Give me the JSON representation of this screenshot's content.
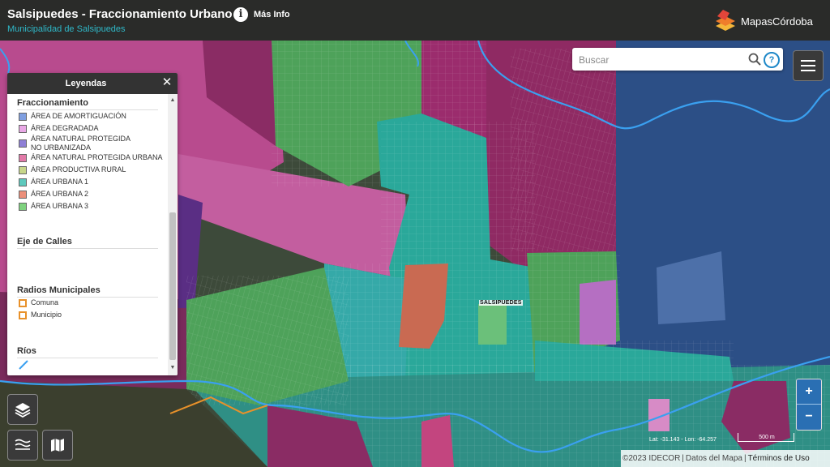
{
  "header": {
    "title": "Salsipuedes - Fraccionamiento Urbano",
    "subtitle": "Municipalidad de Salsipuedes",
    "info_label": "Más Info",
    "brand": "MapasCórdoba"
  },
  "search": {
    "placeholder": "Buscar"
  },
  "legend": {
    "title": "Leyendas",
    "sections": {
      "fraccionamiento": {
        "title": "Fraccionamiento",
        "items": [
          {
            "label": "ÁREA DE AMORTIGUACIÓN",
            "color": "#7f9fe0"
          },
          {
            "label": "ÁREA DEGRADADA",
            "color": "#e9a8e6"
          },
          {
            "label": "ÁREA NATURAL PROTEGIDA\nNO URBANIZADA",
            "color": "#8e7fd6"
          },
          {
            "label": "ÁREA NATURAL PROTEGIDA URBANA",
            "color": "#e27aa8"
          },
          {
            "label": "ÁREA PRODUCTIVA RURAL",
            "color": "#c7d68a"
          },
          {
            "label": "ÁREA URBANA 1",
            "color": "#5ec9bd"
          },
          {
            "label": "ÁREA URBANA 2",
            "color": "#ec8f7a"
          },
          {
            "label": "ÁREA URBANA 3",
            "color": "#7ed27e"
          }
        ]
      },
      "eje_calles": {
        "title": "Eje de Calles"
      },
      "radios": {
        "title": "Radios Municipales",
        "items": [
          {
            "label": "Comuna"
          },
          {
            "label": "Municipio"
          }
        ]
      },
      "rios": {
        "title": "Ríos"
      }
    }
  },
  "map": {
    "place_label": "SALSIPUEDES"
  },
  "status": {
    "coords": "Lat: -31.143 - Lon: -64.257",
    "scale": "500 m",
    "attribution": [
      "©2023 IDECOR",
      "Datos del Mapa",
      "Términos de Uso"
    ]
  },
  "icons": {
    "info": "info-icon",
    "search": "search-icon",
    "help": "help-icon",
    "menu": "hamburger-icon",
    "layers": "layers-icon",
    "legend_toggle": "legend-lines-icon",
    "basemap": "map-icon",
    "close": "close-icon"
  },
  "colors": {
    "accent": "#2fb8c8",
    "zoom_button": "#2a6fb3",
    "help": "#1e88c8",
    "river": "#3aa0f0",
    "radio_outline": "#e8912a"
  }
}
